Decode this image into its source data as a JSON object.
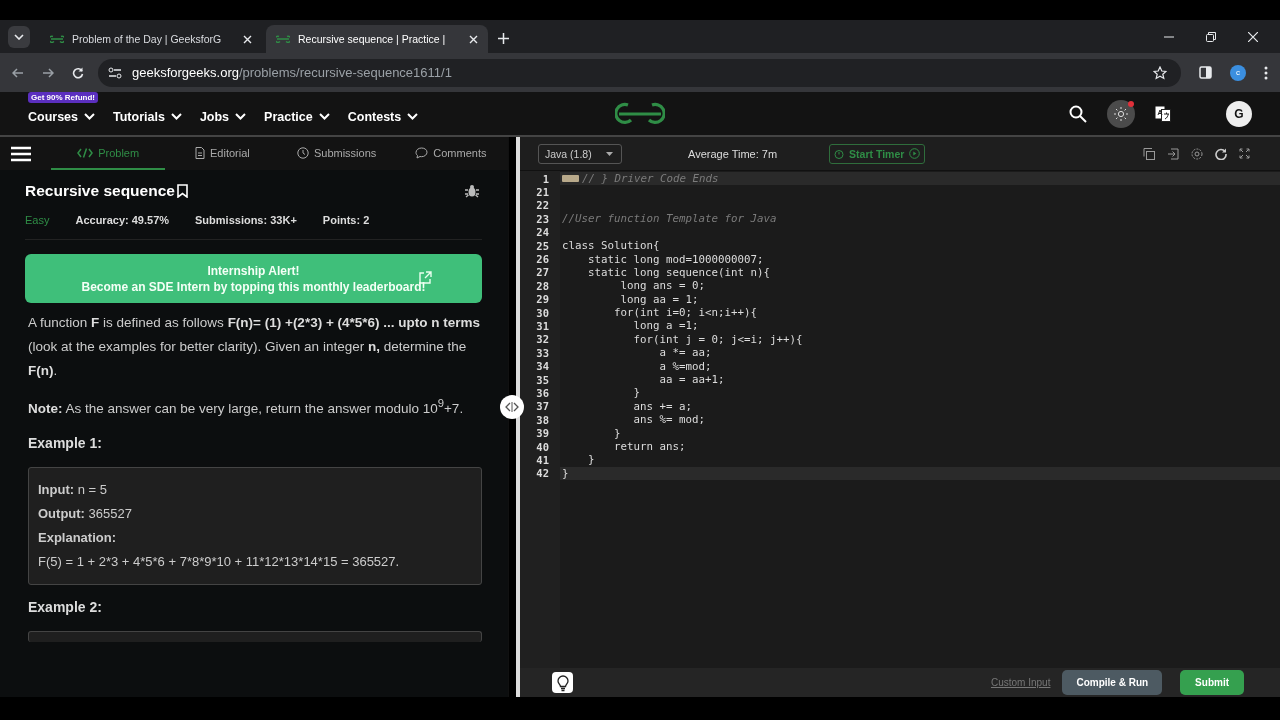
{
  "browser": {
    "tabs": [
      {
        "title": "Problem of the Day | GeeksforG",
        "selected": false
      },
      {
        "title": "Recursive sequence | Practice |",
        "selected": true
      }
    ],
    "url_domain": "geeksforgeeks.org",
    "url_path": "/problems/recursive-sequence1611/1",
    "profile": "c"
  },
  "site_nav": {
    "badge": "Get 90% Refund!",
    "items": [
      "Courses",
      "Tutorials",
      "Jobs",
      "Practice",
      "Contests"
    ],
    "avatar": "G"
  },
  "problem_tabs": [
    {
      "label": "Problem",
      "selected": true
    },
    {
      "label": "Editorial",
      "selected": false
    },
    {
      "label": "Submissions",
      "selected": false
    },
    {
      "label": "Comments",
      "selected": false
    }
  ],
  "problem": {
    "title": "Recursive sequence",
    "difficulty": "Easy",
    "stats": [
      "Accuracy: 49.57%",
      "Submissions: 33K+",
      "Points: 2"
    ],
    "banner": [
      "Internship Alert!",
      "Become an SDE Intern by topping this monthly leaderboard!"
    ],
    "paragraphs": [
      "A function **F** is defined as follows **F(n)= (1) +(2*3) + (4*5*6) ... upto n terms** (look at the examples for better clarity). Given an integer **n,** determine the **F(n)**.",
      "**Note:** As the answer can be very large, return the answer modulo 10$^{9}$+7."
    ],
    "examples": [
      {
        "heading": "Example 1:",
        "lines": [
          "**Input:**  n = 5",
          "**Output:**  365527",
          "Explanation:",
          "F(5) = 1 + 2*3 + 4*5*6 + 7*8*9*10 + 11*12*13*14*15 = 365527."
        ]
      },
      {
        "heading": "Example 2:"
      }
    ]
  },
  "editor": {
    "language": "Java (1.8)",
    "average_time": "Average Time: 7m",
    "timer_button": "Start Timer",
    "lines": [
      {
        "num": "1",
        "text": "// } Driver Code Ends",
        "kind": "comment",
        "folded": true
      },
      {
        "num": "21",
        "folded": false
      },
      {
        "num": "22",
        "folded": false
      },
      {
        "num": "23",
        "text": "//User function Template for Java",
        "kind": "comment",
        "folded": false
      },
      {
        "num": "24",
        "folded": false
      },
      {
        "num": "25",
        "text": "class Solution{",
        "kind": "code",
        "folded": false
      },
      {
        "num": "26",
        "text": "    static long mod=1000000007;",
        "kind": "code",
        "folded": false
      },
      {
        "num": "27",
        "text": "    static long sequence(int n){",
        "kind": "code",
        "folded": false
      },
      {
        "num": "28",
        "text": "         long ans = 0;",
        "kind": "code",
        "folded": false
      },
      {
        "num": "29",
        "text": "         long aa = 1;",
        "kind": "code",
        "folded": false
      },
      {
        "num": "30",
        "text": "        for(int i=0; i<n;i++){",
        "kind": "code",
        "folded": false
      },
      {
        "num": "31",
        "text": "           long a =1;",
        "kind": "code",
        "folded": false
      },
      {
        "num": "32",
        "text": "           for(int j = 0; j<=i; j++){",
        "kind": "code",
        "folded": false
      },
      {
        "num": "33",
        "text": "               a *= aa;",
        "kind": "code",
        "folded": false
      },
      {
        "num": "34",
        "text": "               a %=mod;",
        "kind": "code",
        "folded": false
      },
      {
        "num": "35",
        "text": "               aa = aa+1;",
        "kind": "code",
        "folded": false
      },
      {
        "num": "36",
        "text": "           }",
        "kind": "code",
        "folded": false
      },
      {
        "num": "37",
        "text": "           ans += a;",
        "kind": "code",
        "folded": false
      },
      {
        "num": "38",
        "text": "           ans %= mod;",
        "kind": "code",
        "folded": false
      },
      {
        "num": "39",
        "text": "        }",
        "kind": "code",
        "folded": false
      },
      {
        "num": "40",
        "text": "        return ans;",
        "kind": "code",
        "folded": false
      },
      {
        "num": "41",
        "text": "    }",
        "kind": "code",
        "folded": false
      },
      {
        "num": "42",
        "text": "}",
        "kind": "code",
        "folded": false
      }
    ],
    "custom_input": "Custom Input",
    "compile_button": "Compile & Run",
    "submit_button": "Submit"
  }
}
